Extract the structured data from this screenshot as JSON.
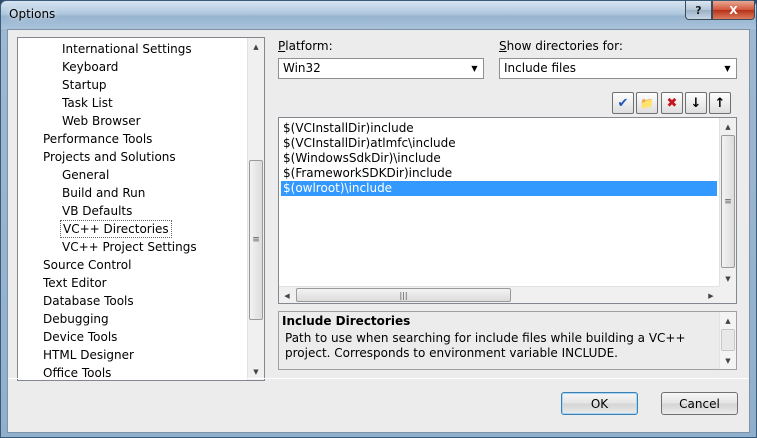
{
  "window": {
    "title": "Options",
    "help_label": "?",
    "close_label": "X"
  },
  "tree": {
    "items": [
      {
        "label": "International Settings",
        "level": 2
      },
      {
        "label": "Keyboard",
        "level": 2
      },
      {
        "label": "Startup",
        "level": 2
      },
      {
        "label": "Task List",
        "level": 2
      },
      {
        "label": "Web Browser",
        "level": 2
      },
      {
        "label": "Performance Tools",
        "level": 1
      },
      {
        "label": "Projects and Solutions",
        "level": 1
      },
      {
        "label": "General",
        "level": 2
      },
      {
        "label": "Build and Run",
        "level": 2
      },
      {
        "label": "VB Defaults",
        "level": 2
      },
      {
        "label": "VC++ Directories",
        "level": 2,
        "selected": true
      },
      {
        "label": "VC++ Project Settings",
        "level": 2
      },
      {
        "label": "Source Control",
        "level": 1
      },
      {
        "label": "Text Editor",
        "level": 1
      },
      {
        "label": "Database Tools",
        "level": 1
      },
      {
        "label": "Debugging",
        "level": 1
      },
      {
        "label": "Device Tools",
        "level": 1
      },
      {
        "label": "HTML Designer",
        "level": 1
      },
      {
        "label": "Office Tools",
        "level": 1
      }
    ]
  },
  "platform": {
    "label": "Platform:",
    "underline_char": "P",
    "rest": "latform:",
    "value": "Win32"
  },
  "show_dirs": {
    "label": "Show directories for:",
    "underline_char": "S",
    "rest": "how directories for:",
    "value": "Include files"
  },
  "toolbar": {
    "check_icon": "✔",
    "new_folder_icon": "📁",
    "delete_icon": "✖",
    "down_icon": "↓",
    "up_icon": "↑"
  },
  "directories": {
    "items": [
      {
        "path": "$(VCInstallDir)include"
      },
      {
        "path": "$(VCInstallDir)atlmfc\\include"
      },
      {
        "path": "$(WindowsSdkDir)\\include"
      },
      {
        "path": "$(FrameworkSDKDir)include"
      },
      {
        "path": "$(owlroot)\\include",
        "selected": true
      }
    ]
  },
  "description": {
    "title": "Include Directories",
    "text": "Path to use when searching for include files while building a VC++ project. Corresponds to environment variable INCLUDE."
  },
  "buttons": {
    "ok": "OK",
    "cancel": "Cancel"
  },
  "scroll_glyphs": {
    "up": "▲",
    "down": "▼",
    "left": "◀",
    "right": "▶",
    "grip_v": "≡",
    "grip_h": "|||"
  },
  "colors": {
    "selection": "#3399ff"
  }
}
